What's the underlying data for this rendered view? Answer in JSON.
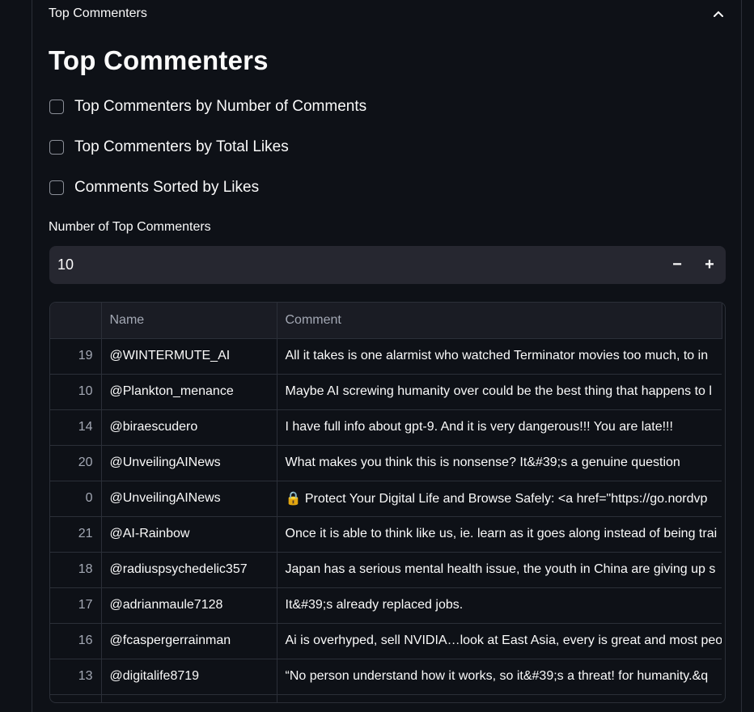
{
  "expander": {
    "title": "Top Commenters"
  },
  "page_title": "Top Commenters",
  "checkboxes": [
    {
      "label": "Top Commenters by Number of Comments",
      "checked": false
    },
    {
      "label": "Top Commenters by Total Likes",
      "checked": false
    },
    {
      "label": "Comments Sorted by Likes",
      "checked": false
    }
  ],
  "number_input": {
    "label": "Number of Top Commenters",
    "value": "10",
    "minus": "−",
    "plus": "+"
  },
  "table": {
    "columns": [
      "",
      "Name",
      "Comment"
    ],
    "rows": [
      {
        "index": "19",
        "name": "@WINTERMUTE_AI",
        "comment": "All it takes is one alarmist who watched Terminator movies too much, to in"
      },
      {
        "index": "10",
        "name": "@Plankton_menance",
        "comment": "Maybe AI screwing humanity over could be the best thing that happens to l"
      },
      {
        "index": "14",
        "name": "@biraescudero",
        "comment": "I have full info about gpt-9. And it is very dangerous!!! You are late!!!"
      },
      {
        "index": "20",
        "name": "@UnveilingAINews",
        "comment": "What makes you think this is nonsense? It&#39;s a genuine question"
      },
      {
        "index": "0",
        "name": "@UnveilingAINews",
        "comment": "🔒 Protect Your Digital Life and Browse Safely: <a href=\"https://go.nordvp"
      },
      {
        "index": "21",
        "name": "@AI-Rainbow",
        "comment": "Once it is able to think like us, ie. learn as it goes along instead of being trai"
      },
      {
        "index": "18",
        "name": "@radiuspsychedelic357",
        "comment": "Japan has a serious mental health issue, the youth in China are giving up s"
      },
      {
        "index": "17",
        "name": "@adrianmaule7128",
        "comment": "It&#39;s already replaced jobs."
      },
      {
        "index": "16",
        "name": "@fcaspergerrainman",
        "comment": "Ai is overhyped, sell NVIDIA…look at East Asia, every is great and most peo"
      },
      {
        "index": "13",
        "name": "@digitalife8719",
        "comment": "“No person understand how it works, so it&#39;s a threat! for humanity.&q"
      },
      {
        "index": "",
        "name": "",
        "comment": ""
      }
    ]
  },
  "colors": {
    "background": "#0e1117",
    "input_bg": "#262730",
    "border": "#2b2f38",
    "header_text": "#a3a8b4"
  }
}
